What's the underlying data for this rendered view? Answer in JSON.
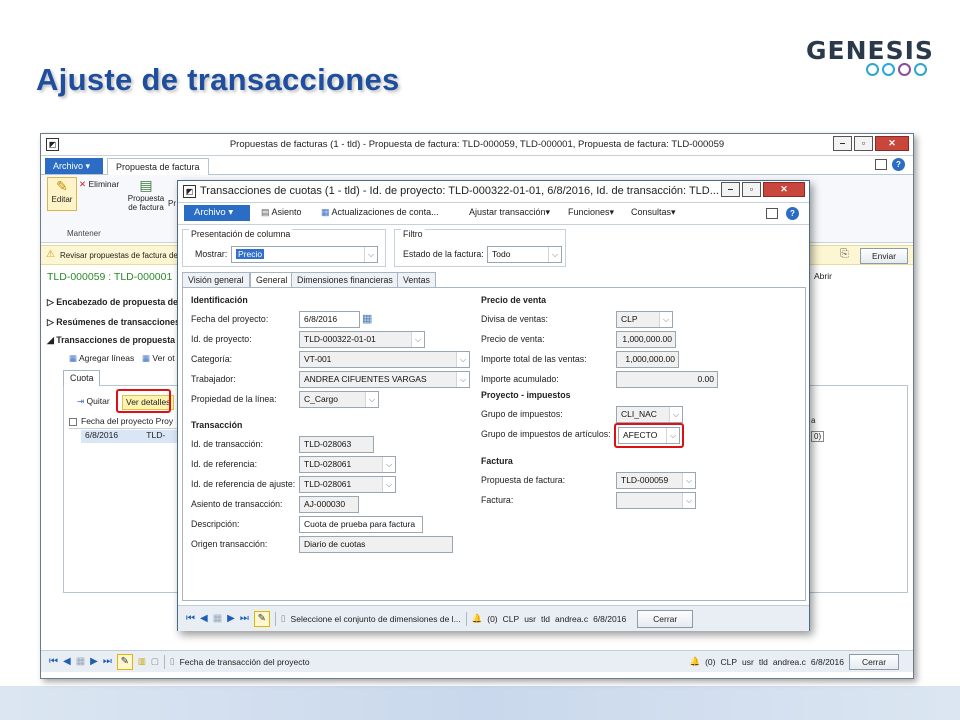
{
  "slide": {
    "title": "Ajuste de transacciones",
    "logo_text": "GENESIS",
    "ring_colors": [
      "#2ea8c9",
      "#27a9e1",
      "#8b4c9e",
      "#2ea8c9"
    ]
  },
  "outer": {
    "title": "Propuestas de facturas (1 - tld) - Propuesta de factura: TLD-000059, TLD-000001, Propuesta de factura: TLD-000059",
    "file_label": "Archivo",
    "ribbon_tab": "Propuesta de factura",
    "editar": "Editar",
    "eliminar": "Eliminar",
    "propuesta_de_factura": "Propuesta de factura",
    "pr": "Pr",
    "mantener": "Mantener",
    "info": "Revisar propuestas de factura de p",
    "enviar": "Enviar",
    "abrir": "Abrir",
    "record_title": "TLD-000059 : TLD-000001",
    "sections": [
      "Encabezado de propuesta de",
      "Resúmenes de transacciones d",
      "Transacciones de propuesta d"
    ],
    "agregar_lineas": "Agregar líneas",
    "ver_ot": "Ver ot",
    "cuota_tab": "Cuota",
    "quitar": "Quitar",
    "ver_detalles": "Ver detalles",
    "grid_headers": [
      "Fecha del proyecto",
      "Proy"
    ],
    "grid_row": [
      "6/8/2016",
      "TLD-"
    ],
    "right_frag": [
      "a",
      "0)"
    ],
    "status_text": "Fecha de transacción del proyecto",
    "status_items": [
      "(0)",
      "CLP",
      "usr",
      "tld",
      "andrea.c",
      "6/8/2016"
    ],
    "cerrar": "Cerrar"
  },
  "inner": {
    "title": "Transacciones de cuotas (1 - tld) - Id. de proyecto: TLD-000322-01-01, 6/8/2016, Id. de transacción: TLD...",
    "file_label": "Archivo",
    "toolbar": [
      "Asiento",
      "Actualizaciones de conta...",
      "Ajustar transacción",
      "Funciones",
      "Consultas"
    ],
    "presentacion": {
      "group": "Presentación de columna",
      "mostrar_label": "Mostrar:",
      "mostrar_value": "Precio"
    },
    "filtro": {
      "group": "Filtro",
      "estado_label": "Estado de la factura:",
      "estado_value": "Todo"
    },
    "tabs": [
      "Visión general",
      "General",
      "Dimensiones financieras",
      "Ventas"
    ],
    "identificacion": {
      "header": "Identificación",
      "fields": [
        {
          "label": "Fecha del proyecto:",
          "value": "6/8/2016"
        },
        {
          "label": "Id. de proyecto:",
          "value": "TLD-000322-01-01"
        },
        {
          "label": "Categoría:",
          "value": "VT-001"
        },
        {
          "label": "Trabajador:",
          "value": "ANDREA CIFUENTES VARGAS"
        },
        {
          "label": "Propiedad de la línea:",
          "value": "C_Cargo"
        }
      ]
    },
    "transaccion": {
      "header": "Transacción",
      "fields": [
        {
          "label": "Id. de transacción:",
          "value": "TLD-028063"
        },
        {
          "label": "Id. de referencia:",
          "value": "TLD-028061"
        },
        {
          "label": "Id. de referencia de ajuste:",
          "value": "TLD-028061"
        },
        {
          "label": "Asiento de transacción:",
          "value": "AJ-000030"
        },
        {
          "label": "Descripción:",
          "value": "Cuota de prueba para factura"
        },
        {
          "label": "Origen transacción:",
          "value": "Diario de cuotas"
        }
      ]
    },
    "precio_venta": {
      "header": "Precio de venta",
      "fields": [
        {
          "label": "Divisa de ventas:",
          "value": "CLP"
        },
        {
          "label": "Precio de venta:",
          "value": "1,000,000.00"
        },
        {
          "label": "Importe total de las ventas:",
          "value": "1,000,000.00"
        },
        {
          "label": "Importe acumulado:",
          "value": "0.00"
        }
      ]
    },
    "impuestos": {
      "header": "Proyecto - impuestos",
      "fields": [
        {
          "label": "Grupo de impuestos:",
          "value": "CLI_NAC"
        },
        {
          "label": "Grupo de impuestos de artículos:",
          "value": "AFECTO"
        }
      ]
    },
    "factura": {
      "header": "Factura",
      "fields": [
        {
          "label": "Propuesta de factura:",
          "value": "TLD-000059"
        },
        {
          "label": "Factura:",
          "value": ""
        }
      ]
    },
    "status_text": "Seleccione el conjunto de dimensiones de l...",
    "status_items": [
      "(0)",
      "CLP",
      "usr",
      "tld",
      "andrea.c",
      "6/8/2016"
    ],
    "cerrar": "Cerrar"
  }
}
